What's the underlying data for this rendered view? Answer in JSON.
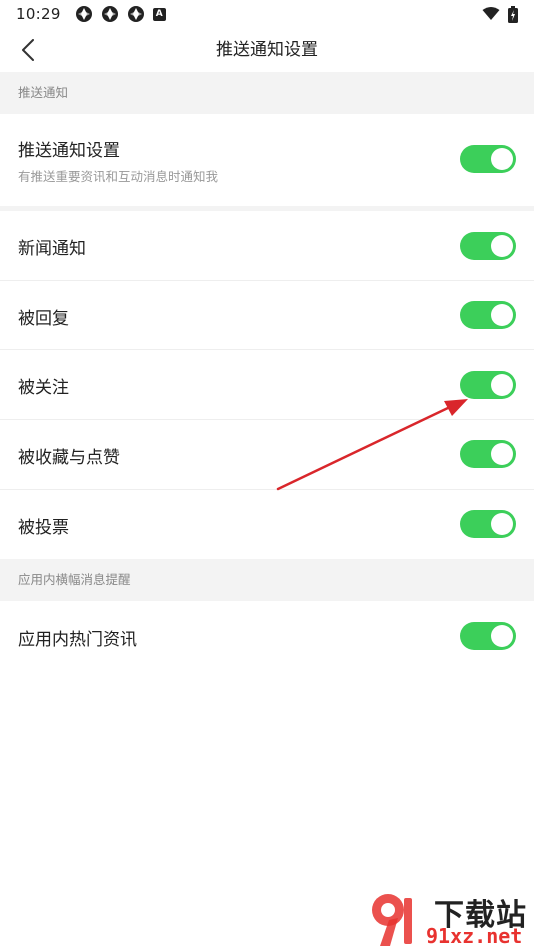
{
  "status_bar": {
    "time": "10:29",
    "left_icons": [
      "app-notification-icon",
      "app-notification-icon",
      "app-notification-icon",
      "a-badge-icon"
    ],
    "right_icons": [
      "wifi-icon",
      "battery-icon"
    ],
    "badge_letter": "A"
  },
  "nav": {
    "back_icon": "chevron-left-icon",
    "title": "推送通知设置"
  },
  "sections": {
    "push": {
      "header": "推送通知"
    },
    "banner": {
      "header": "应用内横幅消息提醒"
    }
  },
  "rows": {
    "push_settings": {
      "label": "推送通知设置",
      "sub": "有推送重要资讯和互动消息时通知我",
      "on": true
    },
    "news": {
      "label": "新闻通知",
      "on": true
    },
    "reply": {
      "label": "被回复",
      "on": true
    },
    "follow": {
      "label": "被关注",
      "on": true
    },
    "fav_like": {
      "label": "被收藏与点赞",
      "on": true
    },
    "vote": {
      "label": "被投票",
      "on": true
    },
    "hot_news": {
      "label": "应用内热门资讯",
      "on": true
    }
  },
  "watermark": {
    "brand": "下载站",
    "domain": "91xz.net",
    "logo_mark": "9"
  },
  "colors": {
    "toggle_on": "#3ccf5a",
    "section_bg": "#f3f3f3",
    "annotation_arrow": "#d9262b",
    "watermark_red": "#e8322f"
  }
}
